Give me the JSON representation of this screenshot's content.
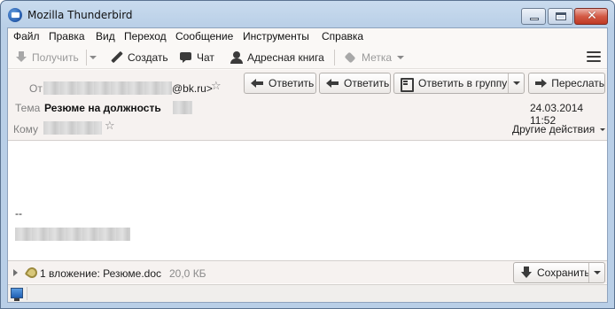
{
  "window": {
    "title": "Mozilla Thunderbird"
  },
  "menu": {
    "items": [
      "Файл",
      "Правка",
      "Вид",
      "Переход",
      "Сообщение",
      "Инструменты",
      "Справка"
    ]
  },
  "toolbar": {
    "get_mail_label": "Получить",
    "write_label": "Создать",
    "chat_label": "Чат",
    "address_book_label": "Адресная книга",
    "tag_label": "Метка"
  },
  "header": {
    "from_label": "От",
    "from_email_visible": "@bk.ru>",
    "subject_label": "Тема",
    "subject": "Резюме на должность",
    "to_label": "Кому",
    "date": "24.03.2014 11:52",
    "other_actions_label": "Другие действия",
    "buttons": {
      "reply": "Ответить",
      "reply_all": "Ответить",
      "reply_list": "Ответить в группу",
      "forward": "Переслать"
    }
  },
  "body": {
    "signature_separator": "--"
  },
  "attachment": {
    "summary": "1 вложение: Резюме.doc",
    "size": "20,0 КБ",
    "save_label": "Сохранить"
  },
  "colors": {
    "titlebar": "#b9cfe7",
    "close_button": "#c8432e",
    "header_background": "#f6f2f0"
  }
}
